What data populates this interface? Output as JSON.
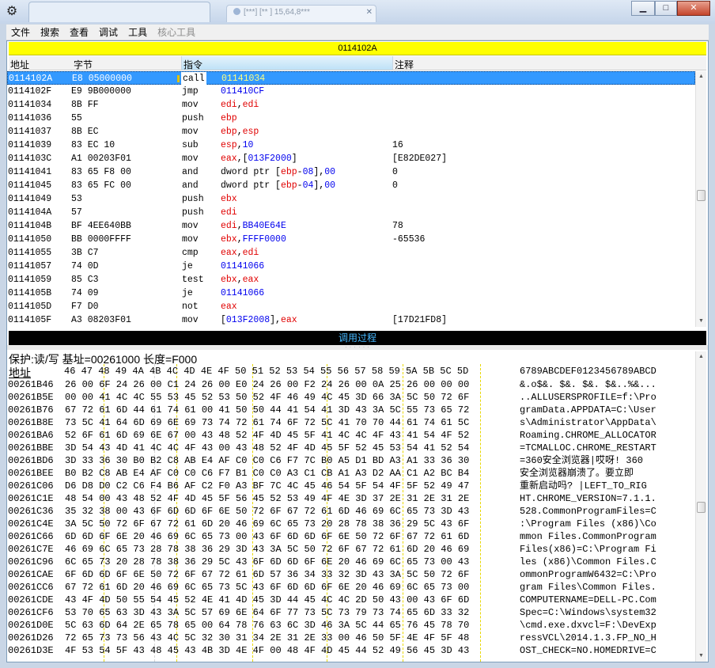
{
  "titlebar": {
    "tab_text": "[***] [** ] 15,64,8***"
  },
  "window_buttons": {
    "minimize": "▁",
    "maximize": "□",
    "close": "✕"
  },
  "menu": {
    "items": [
      "文件",
      "搜索",
      "查看",
      "调试",
      "工具"
    ],
    "disabled_item": "核心工具"
  },
  "address_bar": "0114102A",
  "columns": {
    "addr": "地址",
    "bytes": "字节",
    "instr": "指令",
    "comment": "注释"
  },
  "disasm": [
    {
      "addr": "0114102A",
      "bytes": "E8 05000000",
      "mnem": "call",
      "ops": "01141034",
      "comment": "",
      "selected": true
    },
    {
      "addr": "0114102F",
      "bytes": "E9 9B000000",
      "mnem": "jmp",
      "ops": "011410CF",
      "comment": ""
    },
    {
      "addr": "01141034",
      "bytes": "8B FF",
      "mnem": "mov",
      "ops": "edi,edi",
      "comment": ""
    },
    {
      "addr": "01141036",
      "bytes": "55",
      "mnem": "push",
      "ops": "ebp",
      "comment": ""
    },
    {
      "addr": "01141037",
      "bytes": "8B EC",
      "mnem": "mov",
      "ops": "ebp,esp",
      "comment": ""
    },
    {
      "addr": "01141039",
      "bytes": "83 EC 10",
      "mnem": "sub",
      "ops": "esp,10",
      "comment": "16"
    },
    {
      "addr": "0114103C",
      "bytes": "A1 00203F01",
      "mnem": "mov",
      "ops": "eax,[013F2000]",
      "comment": "[E82DE027]"
    },
    {
      "addr": "01141041",
      "bytes": "83 65 F8 00",
      "mnem": "and",
      "ops": "dword ptr [ebp-08],00",
      "comment": "0"
    },
    {
      "addr": "01141045",
      "bytes": "83 65 FC 00",
      "mnem": "and",
      "ops": "dword ptr [ebp-04],00",
      "comment": "0"
    },
    {
      "addr": "01141049",
      "bytes": "53",
      "mnem": "push",
      "ops": "ebx",
      "comment": ""
    },
    {
      "addr": "0114104A",
      "bytes": "57",
      "mnem": "push",
      "ops": "edi",
      "comment": ""
    },
    {
      "addr": "0114104B",
      "bytes": "BF 4EE640BB",
      "mnem": "mov",
      "ops": "edi,BB40E64E",
      "comment": "78"
    },
    {
      "addr": "01141050",
      "bytes": "BB 0000FFFF",
      "mnem": "mov",
      "ops": "ebx,FFFF0000",
      "comment": "-65536"
    },
    {
      "addr": "01141055",
      "bytes": "3B C7",
      "mnem": "cmp",
      "ops": "eax,edi",
      "comment": ""
    },
    {
      "addr": "01141057",
      "bytes": "74 0D",
      "mnem": "je",
      "ops": "01141066",
      "comment": ""
    },
    {
      "addr": "01141059",
      "bytes": "85 C3",
      "mnem": "test",
      "ops": "ebx,eax",
      "comment": ""
    },
    {
      "addr": "0114105B",
      "bytes": "74 09",
      "mnem": "je",
      "ops": "01141066",
      "comment": ""
    },
    {
      "addr": "0114105D",
      "bytes": "F7 D0",
      "mnem": "not",
      "ops": "eax",
      "comment": ""
    },
    {
      "addr": "0114105F",
      "bytes": "A3 08203F01",
      "mnem": "mov",
      "ops": "[013F2008],eax",
      "comment": "[17D21FD8]"
    }
  ],
  "call_stack_label": "调用过程",
  "memory": {
    "info": "保护:读/写   基址=00261000 长度=F000",
    "header_addr": "地址",
    "header_hex": "46 47 48 49 4A 4B 4C 4D 4E 4F 50 51 52 53 54 55 56 57 58 59 5A 5B 5C 5D",
    "header_ascii": "6789ABCDEF0123456789ABCD",
    "rows": [
      {
        "addr": "00261B46",
        "hex": "26 00 6F 24 26 00 C1 24 26 00 E0 24 26 00 F2 24 26 00 0A 25 26 00 00 00",
        "ascii": "&.o$&. $&. $&. $&..%&..."
      },
      {
        "addr": "00261B5E",
        "hex": "00 00 41 4C 4C 55 53 45 52 53 50 52 4F 46 49 4C 45 3D 66 3A 5C 50 72 6F",
        "ascii": "..ALLUSERSPROFILE=f:\\Pro"
      },
      {
        "addr": "00261B76",
        "hex": "67 72 61 6D 44 61 74 61 00 41 50 50 44 41 54 41 3D 43 3A 5C 55 73 65 72",
        "ascii": "gramData.APPDATA=C:\\User"
      },
      {
        "addr": "00261B8E",
        "hex": "73 5C 41 64 6D 69 6E 69 73 74 72 61 74 6F 72 5C 41 70 70 44 61 74 61 5C",
        "ascii": "s\\Administrator\\AppData\\"
      },
      {
        "addr": "00261BA6",
        "hex": "52 6F 61 6D 69 6E 67 00 43 48 52 4F 4D 45 5F 41 4C 4C 4F 43 41 54 4F 52",
        "ascii": "Roaming.CHROME_ALLOCATOR"
      },
      {
        "addr": "00261BBE",
        "hex": "3D 54 43 4D 41 4C 4C 4F 43 00 43 48 52 4F 4D 45 5F 52 45 53 54 41 52 54",
        "ascii": "=TCMALLOC.CHROME_RESTART"
      },
      {
        "addr": "00261BD6",
        "hex": "3D 33 36 30 B0 B2 C8 AB E4 AF C0 C0 C6 F7 7C B0 A5 D1 BD A3 A1 33 36 30",
        "ascii": "=360安全浏览器|哎呀! 360"
      },
      {
        "addr": "00261BEE",
        "hex": "B0 B2 C8 AB E4 AF C0 C0 C6 F7 B1 C0 C0 A3 C1 CB A1 A3 D2 AA C1 A2 BC B4",
        "ascii": "安全浏览器崩溃了。要立即"
      },
      {
        "addr": "00261C06",
        "hex": "D6 D8 D0 C2 C6 F4 B6 AF C2 F0 A3 BF 7C 4C 45 46 54 5F 54 4F 5F 52 49 47",
        "ascii": "重新启动吗? |LEFT_TO_RIG"
      },
      {
        "addr": "00261C1E",
        "hex": "48 54 00 43 48 52 4F 4D 45 5F 56 45 52 53 49 4F 4E 3D 37 2E 31 2E 31 2E",
        "ascii": "HT.CHROME_VERSION=7.1.1."
      },
      {
        "addr": "00261C36",
        "hex": "35 32 38 00 43 6F 6D 6D 6F 6E 50 72 6F 67 72 61 6D 46 69 6C 65 73 3D 43",
        "ascii": "528.CommonProgramFiles=C"
      },
      {
        "addr": "00261C4E",
        "hex": "3A 5C 50 72 6F 67 72 61 6D 20 46 69 6C 65 73 20 28 78 38 36 29 5C 43 6F",
        "ascii": ":\\Program Files (x86)\\Co"
      },
      {
        "addr": "00261C66",
        "hex": "6D 6D 6F 6E 20 46 69 6C 65 73 00 43 6F 6D 6D 6F 6E 50 72 6F 67 72 61 6D",
        "ascii": "mmon Files.CommonProgram"
      },
      {
        "addr": "00261C7E",
        "hex": "46 69 6C 65 73 28 78 38 36 29 3D 43 3A 5C 50 72 6F 67 72 61 6D 20 46 69",
        "ascii": "Files(x86)=C:\\Program Fi"
      },
      {
        "addr": "00261C96",
        "hex": "6C 65 73 20 28 78 38 36 29 5C 43 6F 6D 6D 6F 6E 20 46 69 6C 65 73 00 43",
        "ascii": "les (x86)\\Common Files.C"
      },
      {
        "addr": "00261CAE",
        "hex": "6F 6D 6D 6F 6E 50 72 6F 67 72 61 6D 57 36 34 33 32 3D 43 3A 5C 50 72 6F",
        "ascii": "ommonProgramW6432=C:\\Pro"
      },
      {
        "addr": "00261CC6",
        "hex": "67 72 61 6D 20 46 69 6C 65 73 5C 43 6F 6D 6D 6F 6E 20 46 69 6C 65 73 00",
        "ascii": "gram Files\\Common Files."
      },
      {
        "addr": "00261CDE",
        "hex": "43 4F 4D 50 55 54 45 52 4E 41 4D 45 3D 44 45 4C 4C 2D 50 43 00 43 6F 6D",
        "ascii": "COMPUTERNAME=DELL-PC.Com"
      },
      {
        "addr": "00261CF6",
        "hex": "53 70 65 63 3D 43 3A 5C 57 69 6E 64 6F 77 73 5C 73 79 73 74 65 6D 33 32",
        "ascii": "Spec=C:\\Windows\\system32"
      },
      {
        "addr": "00261D0E",
        "hex": "5C 63 6D 64 2E 65 78 65 00 64 78 76 63 6C 3D 46 3A 5C 44 65 76 45 78 70",
        "ascii": "\\cmd.exe.dxvcl=F:\\DevExp"
      },
      {
        "addr": "00261D26",
        "hex": "72 65 73 73 56 43 4C 5C 32 30 31 34 2E 31 2E 33 00 46 50 5F 4E 4F 5F 48",
        "ascii": "ressVCL\\2014.1.3.FP_NO_H"
      },
      {
        "addr": "00261D3E",
        "hex": "4F 53 54 5F 43 48 45 43 4B 3D 4E 4F 00 48 4F 4D 45 44 52 49 56 45 3D 43",
        "ascii": "OST_CHECK=NO.HOMEDRIVE=C"
      }
    ]
  }
}
